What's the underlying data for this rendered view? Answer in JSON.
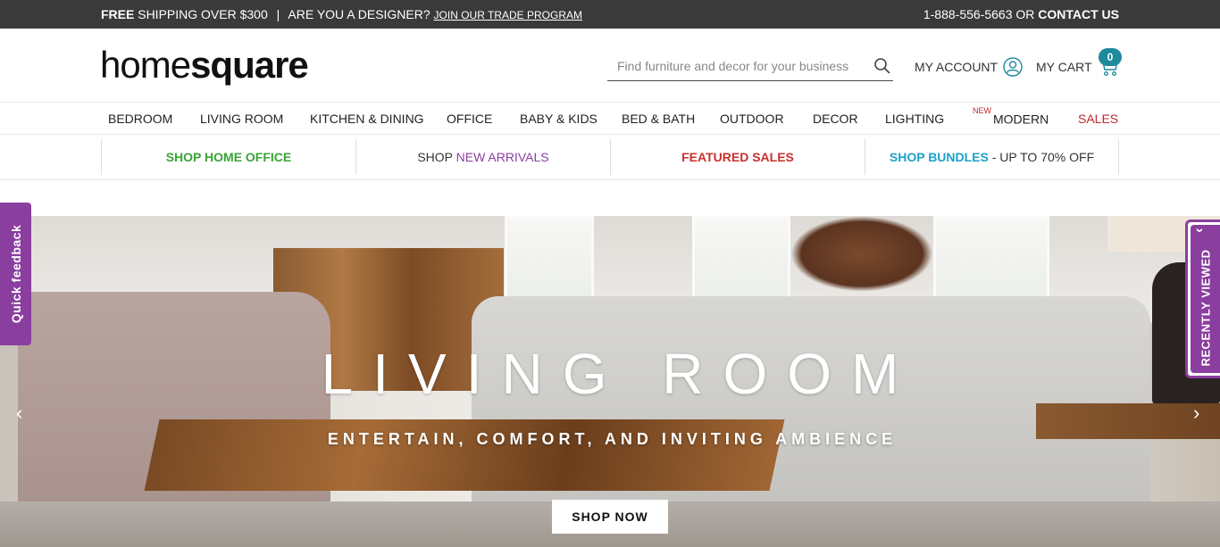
{
  "topbar": {
    "free": "FREE",
    "shipping": "SHIPPING OVER $300",
    "divider": "|",
    "designer": "ARE YOU A DESIGNER?",
    "trade_link": "JOIN OUR TRADE PROGRAM",
    "phone": "1-888-556-5663 OR",
    "contact": "CONTACT US"
  },
  "header": {
    "logo_thin": "home",
    "logo_bold": "square",
    "search_placeholder": "Find furniture and decor for your business",
    "account_label": "MY ACCOUNT",
    "cart_label": "MY CART",
    "cart_count": "0"
  },
  "nav": {
    "items": [
      {
        "label": "BEDROOM"
      },
      {
        "label": "LIVING ROOM"
      },
      {
        "label": "KITCHEN & DINING"
      },
      {
        "label": "OFFICE"
      },
      {
        "label": "BABY & KIDS"
      },
      {
        "label": "BED & BATH"
      },
      {
        "label": "OUTDOOR"
      },
      {
        "label": "DECOR"
      },
      {
        "label": "LIGHTING"
      }
    ],
    "modern_badge": "NEW",
    "modern_label": "MODERN",
    "sales_label": "SALES"
  },
  "promos": {
    "home_office": "SHOP HOME OFFICE",
    "arrivals_prefix": "SHOP",
    "arrivals": "NEW ARRIVALS",
    "featured": "FEATURED SALES",
    "bundles": "SHOP BUNDLES",
    "bundles_suffix": "- UP TO 70% OFF"
  },
  "hero": {
    "title": "LIVING ROOM",
    "subtitle": "ENTERTAIN, COMFORT, AND INVITING AMBIENCE",
    "cta": "SHOP NOW",
    "prev": "‹",
    "next": "›"
  },
  "side_tabs": {
    "feedback": "Quick feedback",
    "recent": "RECENTLY VIEWED",
    "recent_chevron": "‹"
  },
  "colors": {
    "topbar_bg": "#3a3a3a",
    "brand_purple": "#8a3e9e",
    "green": "#3aa435",
    "red": "#c9302c",
    "blue": "#1ba2c8",
    "cart_badge": "#1e8a9c"
  },
  "icons": [
    "search-icon",
    "account-icon",
    "cart-icon",
    "chevron-left-icon",
    "chevron-right-icon"
  ]
}
